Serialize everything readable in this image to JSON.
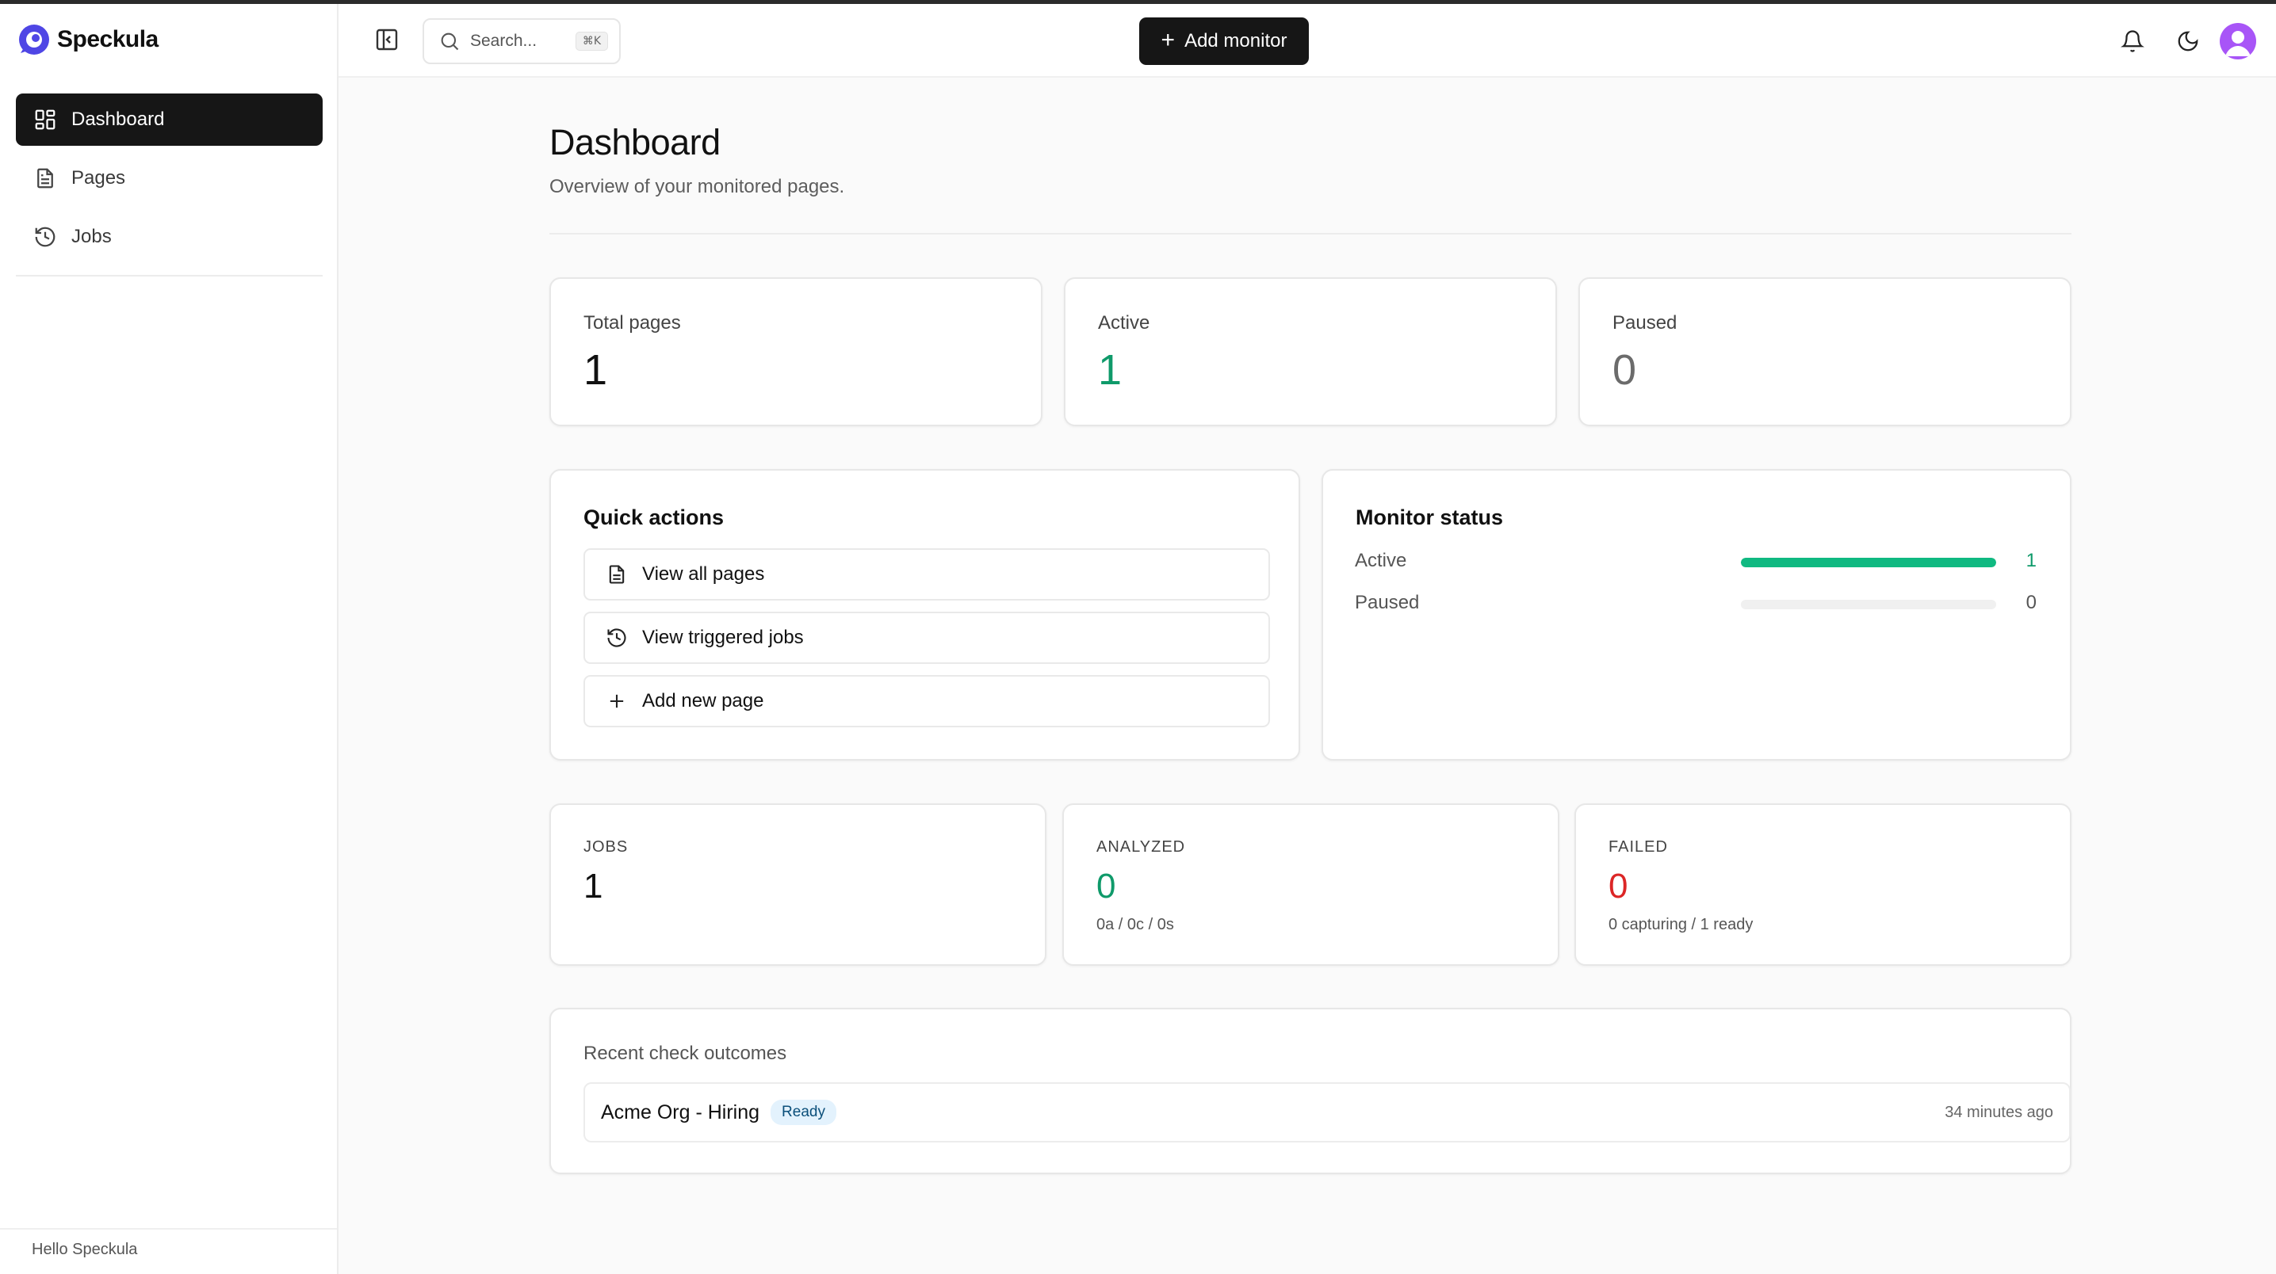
{
  "brand": {
    "name": "Speckula",
    "logo_color": "#4f46e5"
  },
  "sidebar": {
    "items": [
      {
        "label": "Dashboard",
        "icon": "dashboard-icon",
        "active": true
      },
      {
        "label": "Pages",
        "icon": "file-icon",
        "active": false
      },
      {
        "label": "Jobs",
        "icon": "history-icon",
        "active": false
      }
    ],
    "footer": "Hello Speckula"
  },
  "header": {
    "search_label": "Search...",
    "search_shortcut": "⌘K",
    "add_label": "Add monitor",
    "icons": [
      "sidebar-toggle-icon",
      "search-icon",
      "bell-icon",
      "moon-icon",
      "avatar"
    ]
  },
  "page": {
    "title": "Dashboard",
    "subtitle": "Overview of your monitored pages."
  },
  "stats": [
    {
      "label": "Total pages",
      "value": "1",
      "color": "#111111"
    },
    {
      "label": "Active",
      "value": "1",
      "color": "#0f9a6a"
    },
    {
      "label": "Paused",
      "value": "0",
      "color": "#6b6b6b"
    }
  ],
  "quick_actions": {
    "title": "Quick actions",
    "items": [
      {
        "label": "View all pages",
        "icon": "file-icon"
      },
      {
        "label": "View triggered jobs",
        "icon": "history-icon"
      },
      {
        "label": "Add new page",
        "icon": "plus-icon"
      }
    ]
  },
  "monitor_status": {
    "title": "Monitor status",
    "rows": [
      {
        "label": "Active",
        "count": "1",
        "fraction": 1.0,
        "count_color": "#0f9a6a"
      },
      {
        "label": "Paused",
        "count": "0",
        "fraction": 0.0,
        "count_color": "#555555"
      }
    ]
  },
  "job_stats": [
    {
      "label": "JOBS",
      "value": "1",
      "sub": "",
      "color": "#111111"
    },
    {
      "label": "ANALYZED",
      "value": "0",
      "sub": "0a / 0c / 0s",
      "color": "#0f9a6a"
    },
    {
      "label": "FAILED",
      "value": "0",
      "sub": "0 capturing / 1 ready",
      "color": "#dc2626"
    }
  ],
  "recent": {
    "title": "Recent check outcomes",
    "items": [
      {
        "name": "Acme Org - Hiring",
        "status": "Ready",
        "time": "34 minutes ago"
      }
    ]
  }
}
